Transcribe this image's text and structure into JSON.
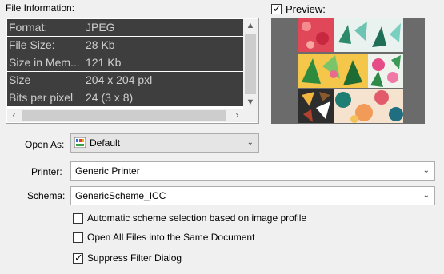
{
  "file_info": {
    "label": "File Information:",
    "rows": [
      {
        "key": "Format:",
        "value": "JPEG"
      },
      {
        "key": "File Size:",
        "value": "28 Kb"
      },
      {
        "key": "Size in Mem...",
        "value": "121 Kb"
      },
      {
        "key": "Size",
        "value": "204 x 204 pxl"
      },
      {
        "key": "Bits per pixel",
        "value": "24 (3 x 8)"
      }
    ]
  },
  "preview": {
    "label": "Preview:",
    "checked": true
  },
  "open_as": {
    "label": "Open As:",
    "value": "Default",
    "icon": "color-palette-icon"
  },
  "printer": {
    "label": "Printer:",
    "value": "Generic Printer"
  },
  "schema": {
    "label": "Schema:",
    "value": "GenericScheme_ICC"
  },
  "options": {
    "auto_scheme": {
      "label": "Automatic scheme selection based on image profile",
      "checked": false
    },
    "open_all": {
      "label": "Open All Files into the Same Document",
      "checked": false
    },
    "suppress_filter": {
      "label": "Suppress Filter Dialog",
      "checked": true
    }
  },
  "colors": {
    "table_row_bg": "#3e3e3e",
    "preview_bg": "#6b6b6b",
    "window_bg": "#f0f0f0"
  }
}
